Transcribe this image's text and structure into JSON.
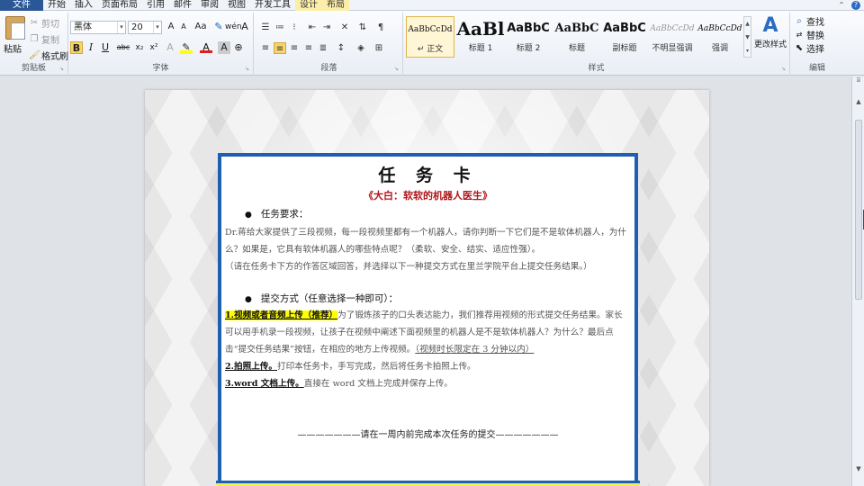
{
  "menu": {
    "file": "文件",
    "tabs": [
      "开始",
      "插入",
      "页面布局",
      "引用",
      "邮件",
      "审阅",
      "视图",
      "开发工具"
    ],
    "context_tabs": [
      "设计",
      "布局"
    ]
  },
  "clipboard": {
    "paste": "粘贴",
    "cut": "剪切",
    "copy": "复制",
    "format_painter": "格式刷",
    "label": "剪贴板"
  },
  "font": {
    "name": "黑体",
    "size": "20",
    "label": "字体",
    "bold": "B",
    "italic": "I",
    "underline": "U",
    "strike": "abc",
    "sub": "x₂",
    "sup": "x²",
    "aa": "Aa",
    "grow": "A",
    "shrink": "A"
  },
  "paragraph": {
    "label": "段落"
  },
  "styles": {
    "label": "样式",
    "items": [
      {
        "sample": "AaBbCcDd",
        "name": "↵ 正文",
        "selected": true
      },
      {
        "sample": "AaBl",
        "name": "标题 1",
        "selected": false
      },
      {
        "sample": "AaBbC",
        "name": "标题 2",
        "selected": false
      },
      {
        "sample": "AaBbC",
        "name": "标题",
        "selected": false
      },
      {
        "sample": "AaBbC",
        "name": "副标题",
        "selected": false
      },
      {
        "sample": "AaBbCcDd",
        "name": "不明显强调",
        "selected": false
      },
      {
        "sample": "AaBbCcDd",
        "name": "强调",
        "selected": false
      }
    ],
    "change_styles": "更改样式"
  },
  "editing": {
    "label": "编辑",
    "find": "查找",
    "replace": "替换",
    "select": "选择"
  },
  "document": {
    "title": "任 务 卡",
    "subtitle": "《大白：软软的机器人医生》",
    "req_heading": "任务要求：",
    "req_para1": "Dr.蒋给大家提供了三段视频，每一段视频里都有一个机器人，请你判断一下它们是不是软体机器人，为什么？如果是，它具有软体机器人的哪些特点呢？（柔软、安全、结实、适应性强）。",
    "req_para2": "（请在任务卡下方的作答区域回答，并选择以下一种提交方式在里兰学院平台上提交任务结果。）",
    "submit_heading": "提交方式（任意选择一种即可）：",
    "opt1_label": "1.视频或者音频上传（推荐）",
    "opt1_text": "为了锻炼孩子的口头表达能力，我们推荐用视频的形式提交任务结果。家长可以用手机录一段视频，让孩子在视频中阐述下面视频里的机器人是不是软体机器人？为什么？最后点击“提交任务结果”按钮，在相应的地方上传视频。",
    "opt1_note": "（视频时长限定在 3 分钟以内）",
    "opt2_label": "2.拍照上传。",
    "opt2_text": "打印本任务卡，手写完成，然后将任务卡拍照上传。",
    "opt3_label": "3.word 文档上传。",
    "opt3_text": "直接在 word 文档上完成并保存上传。",
    "footer": "———————请在一周内前完成本次任务的提交———————"
  },
  "colors": {
    "accent": "#1f5fb0",
    "subtitle_red": "#b0161c",
    "highlight": "#ffff00"
  }
}
